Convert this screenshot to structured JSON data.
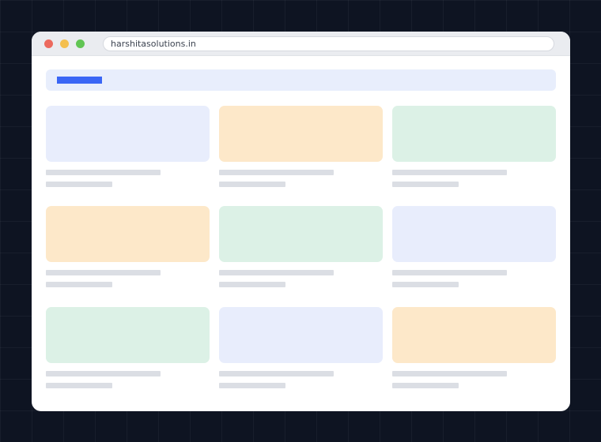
{
  "browser": {
    "url": "harshitasolutions.in",
    "traffic_lights": {
      "close_color": "#ec6a5e",
      "minimize_color": "#f4bf4f",
      "zoom_color": "#61c554"
    }
  },
  "page": {
    "header_accent_color": "#3a66f5",
    "cards": [
      {
        "image_color": "#e8edfc"
      },
      {
        "image_color": "#fde8c9"
      },
      {
        "image_color": "#dcf1e6"
      },
      {
        "image_color": "#fde8c9"
      },
      {
        "image_color": "#dcf1e6"
      },
      {
        "image_color": "#e8edfc"
      },
      {
        "image_color": "#dcf1e6"
      },
      {
        "image_color": "#e8edfc"
      },
      {
        "image_color": "#fde8c9"
      }
    ]
  }
}
